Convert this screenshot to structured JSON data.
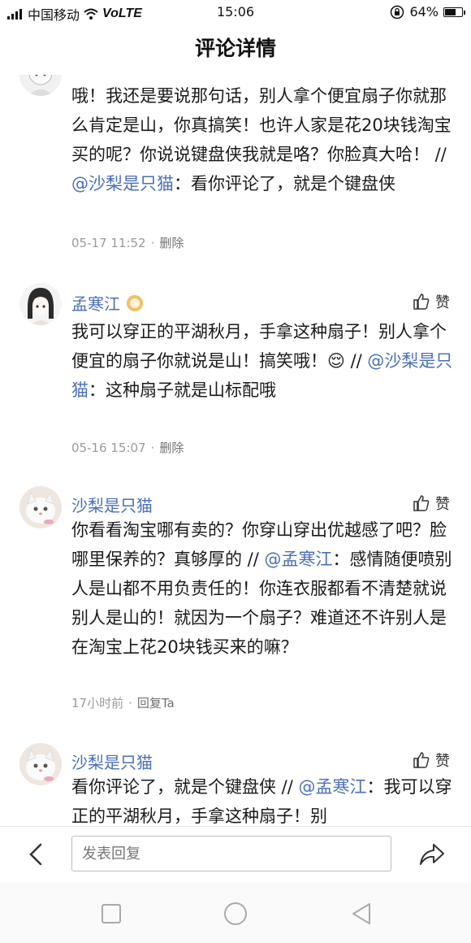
{
  "status_bar": {
    "carrier": "中国移动",
    "network": "VoLTE",
    "time": "15:06",
    "battery": "64%",
    "battery_level": 0.64
  },
  "header": {
    "title": "评论详情"
  },
  "comments": [
    {
      "text_before": "哦！我还是要说那句话，别人拿个便宜扇子你就那么肯定是山，你真搞笑！也许人家是花20块钱淘宝买的呢？你说说键盘侠我就是咯？你脸真大哈！ // ",
      "mention": "@沙梨是只猫",
      "text_after": "：看你评论了，就是个键盘侠",
      "time": "05-17 11:52",
      "action": "删除"
    },
    {
      "author": "孟寒江",
      "like_label": "赞",
      "text_before": "我可以穿正的平湖秋月，手拿这种扇子！别人拿个便宜的扇子你就说是山！搞笑哦！😌 // ",
      "mention": "@沙梨是只猫",
      "text_after": "：这种扇子就是山标配哦",
      "time": "05-16 15:07",
      "action": "删除"
    },
    {
      "author": "沙梨是只猫",
      "like_label": "赞",
      "text_before": "你看看淘宝哪有卖的？你穿山穿出优越感了吧？脸哪里保养的？真够厚的 // ",
      "mention": "@孟寒江",
      "text_after": "：感情随便喷别人是山都不用负责任的！你连衣服都看不清楚就说别人是山的！就因为一个扇子？难道还不许别人是在淘宝上花20块钱买来的嘛？",
      "time": "17小时前",
      "action": "回复Ta"
    },
    {
      "author": "沙梨是只猫",
      "like_label": "赞",
      "text_before": "看你评论了，就是个键盘侠 // ",
      "mention": "@孟寒江",
      "text_after": "：我可以穿正的平湖秋月，手拿这种扇子！别"
    }
  ],
  "bottom_bar": {
    "reply_placeholder": "发表回复"
  },
  "colors": {
    "accent": "#4a6fb5",
    "meta": "#9a9a9a"
  }
}
